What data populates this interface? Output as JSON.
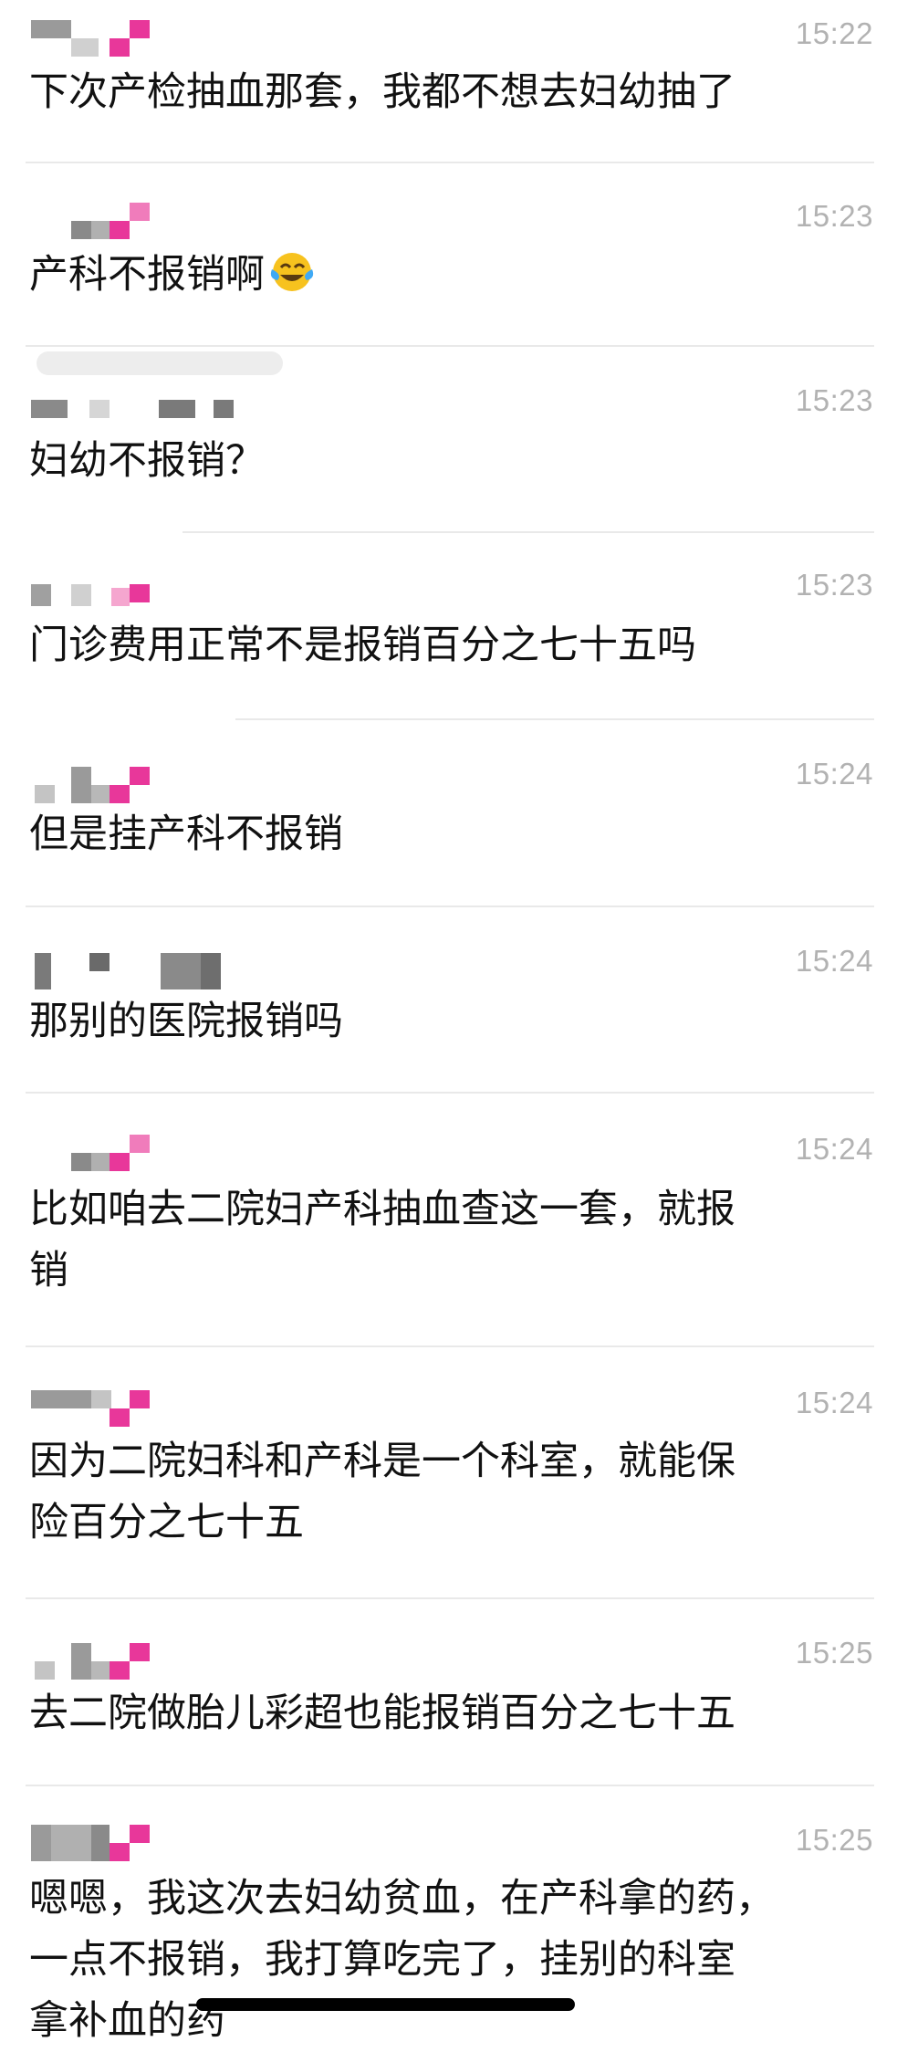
{
  "colors": {
    "background": "#ffffff",
    "text": "#111111",
    "time": "#b2b2b2",
    "divider": "#e9e9e9",
    "avatar_pink": "#e8379a",
    "avatar_gray": "#8a8a8a"
  },
  "messages": [
    {
      "time": "15:22",
      "text": "下次产检抽血那套，我都不想去妇幼抽了"
    },
    {
      "time": "15:23",
      "text": "产科不报销啊",
      "emoji": "crying-laughing-face-icon"
    },
    {
      "time": "15:23",
      "text": "妇幼不报销？"
    },
    {
      "time": "15:23",
      "text": "门诊费用正常不是报销百分之七十五吗"
    },
    {
      "time": "15:24",
      "text": "但是挂产科不报销"
    },
    {
      "time": "15:24",
      "text": "那别的医院报销吗"
    },
    {
      "time": "15:24",
      "text": "比如咱去二院妇产科抽血查这一套，就报\n销"
    },
    {
      "time": "15:24",
      "text": "因为二院妇科和产科是一个科室，就能保\n险百分之七十五"
    },
    {
      "time": "15:25",
      "text": "去二院做胎儿彩超也能报销百分之七十五"
    },
    {
      "time": "15:25",
      "text": "嗯嗯，我这次去妇幼贫血，在产科拿的药，\n一点不报销，我打算吃完了，挂别的科室\n拿补血的药"
    }
  ]
}
